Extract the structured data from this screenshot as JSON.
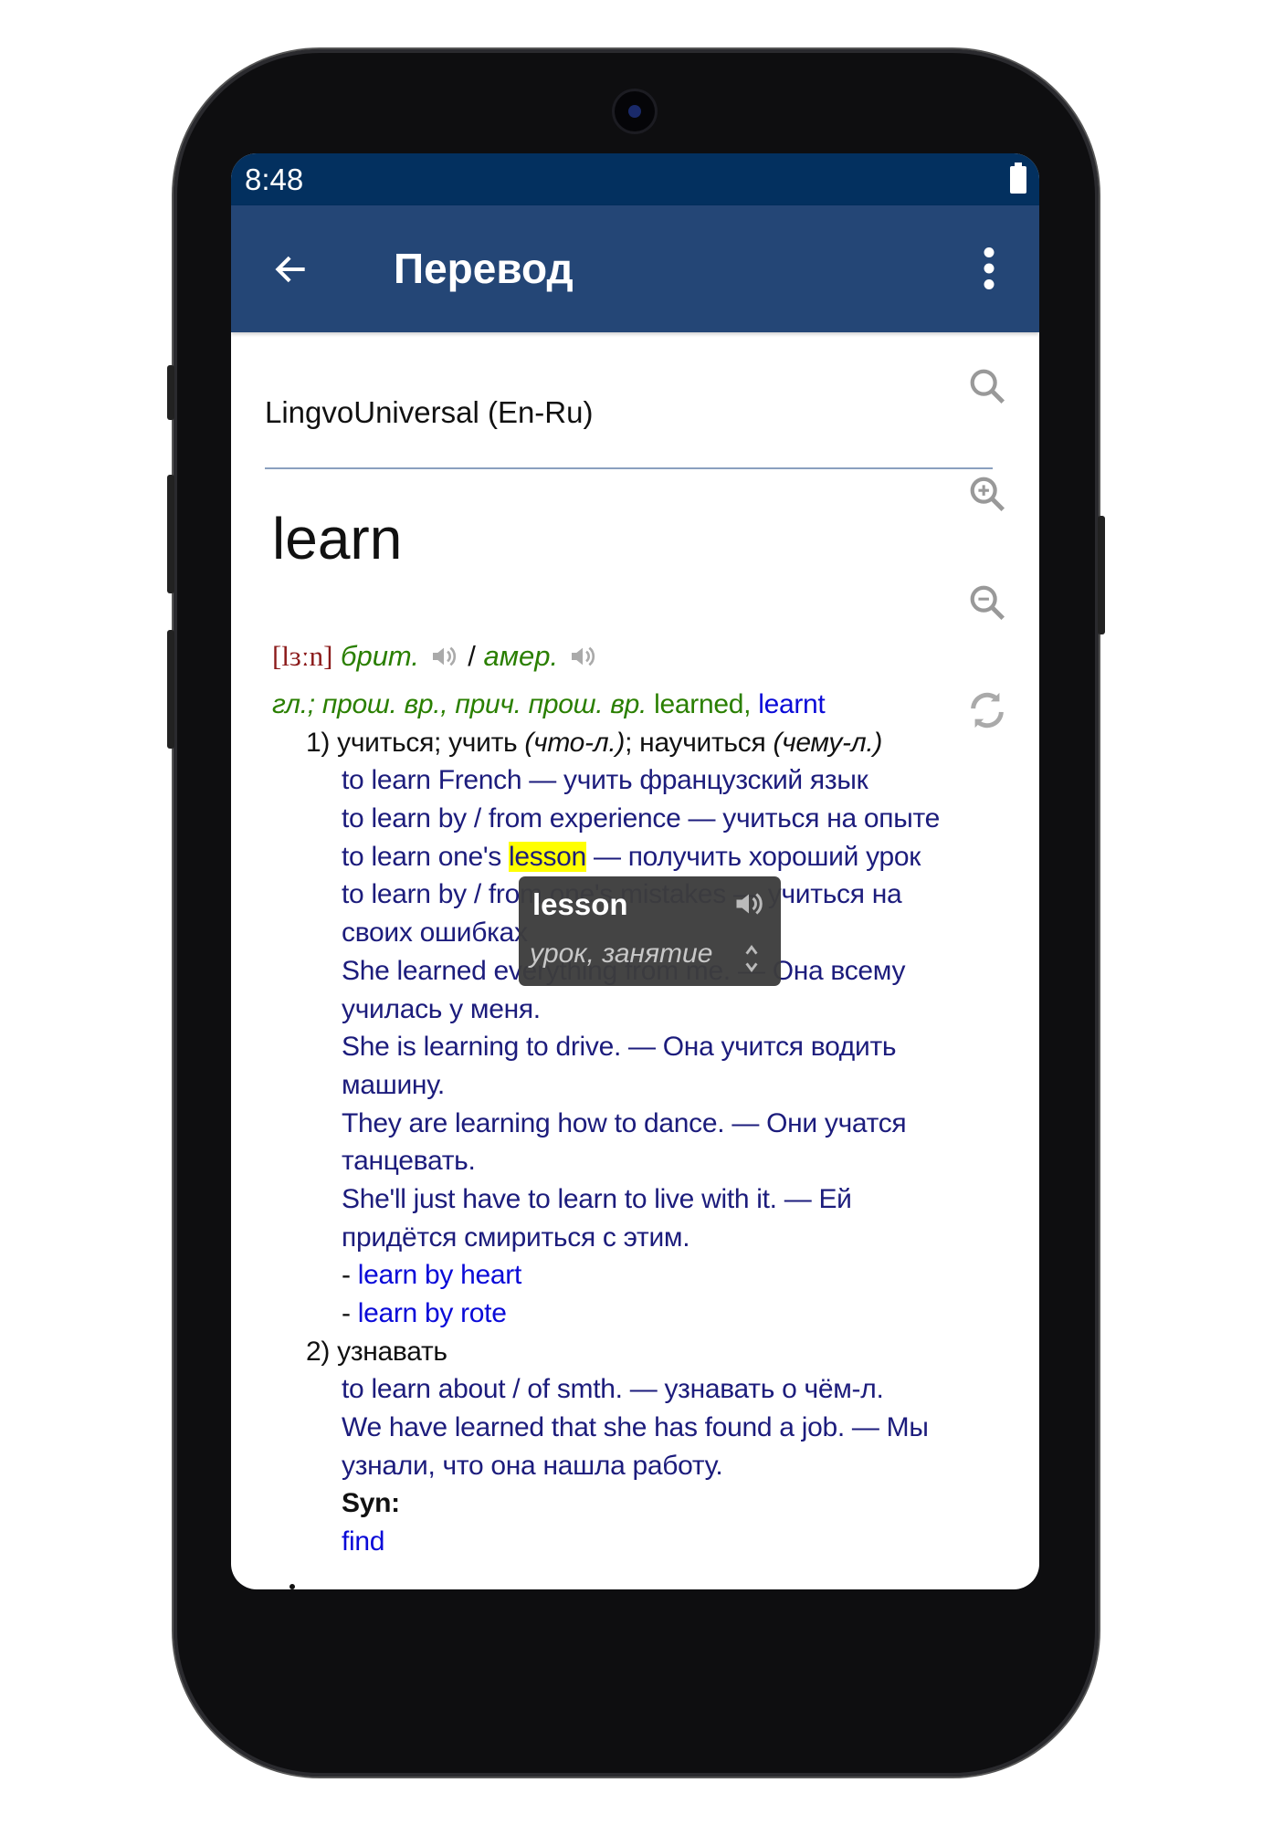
{
  "status_bar": {
    "time": "8:48"
  },
  "app_bar": {
    "title": "Перевод",
    "back_icon": "arrow-left-icon",
    "menu_icon": "more-vertical-icon"
  },
  "dictionary_name": "LingvoUniversal (En-Ru)",
  "headword": "learn",
  "tools": [
    "search-icon",
    "zoom-in-icon",
    "zoom-out-icon",
    "refresh-icon"
  ],
  "transcription": {
    "ipa": "[lɜːn]",
    "brit": "брит.",
    "sep": " / ",
    "amer": "амер."
  },
  "grammar": {
    "label": "гл.; прош. вр., прич. прош. вр.",
    "form1": " learned,",
    "form2": "learnt"
  },
  "sense1": {
    "num": "1) ",
    "def_a": "учиться; учить ",
    "def_b": "(что-л.)",
    "def_c": "; научиться ",
    "def_d": "(чему-л.)",
    "ex1": "to learn French — учить французский язык",
    "ex2": "to learn by / from experience — учиться на опыте",
    "ex3_a": "to learn one's ",
    "ex3_hl": "lesson",
    "ex3_b": " — получить хороший урок",
    "ex4_l1": "to learn by / from one's mistakes — учиться на",
    "ex4_l2": "своих ошибках",
    "ex5_l1": "She learned everything from me. — Она всему",
    "ex5_l2": "училась у меня.",
    "ex6_l1": "She is learning to drive. — Она учится водить",
    "ex6_l2": "машину.",
    "ex7_l1": "They are learning how to dance. — Они учатся",
    "ex7_l2": "танцевать.",
    "ex8_l1": "She'll just have to learn to live with it. — Ей",
    "ex8_l2": "придётся смириться с этим.",
    "idioms": [
      {
        "dash": "- ",
        "text": "learn by heart"
      },
      {
        "dash": "- ",
        "text": "learn by rote"
      }
    ]
  },
  "sense2": {
    "num": "2) ",
    "def": "узнавать",
    "ex1": "to learn about / of smth. — узнавать о чём-л.",
    "ex2_l1": "We have learned that she has found a job. — Мы",
    "ex2_l2": "узнали, что она нашла работу.",
    "syn_label": "Syn:",
    "syn": "find"
  },
  "popup": {
    "word": "lesson",
    "translation": "урок, занятие"
  },
  "colors": {
    "status_bar": "#03305f",
    "app_bar": "#244676",
    "example": "#1c1c7c",
    "link": "#0a0ad8",
    "grammar": "#2a7f00",
    "transcription": "#8b1a1a",
    "highlight": "#ffff00"
  }
}
